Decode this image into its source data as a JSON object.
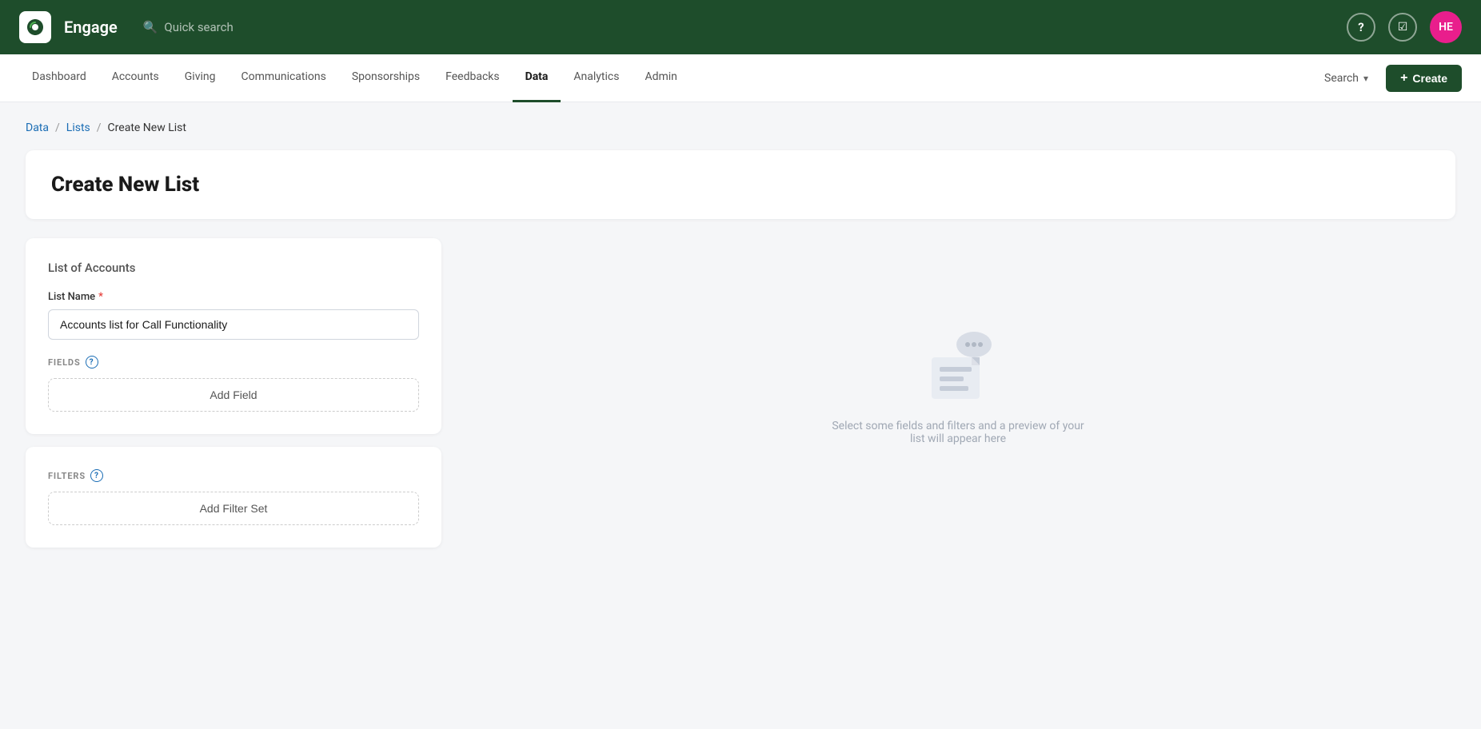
{
  "app": {
    "brand": "Engage",
    "logo_alt": "engage-logo"
  },
  "topbar": {
    "quick_search_placeholder": "Quick search",
    "avatar_initials": "HE",
    "avatar_color": "#e91e8c",
    "help_icon": "?",
    "checklist_icon": "✓"
  },
  "mainnav": {
    "items": [
      {
        "label": "Dashboard",
        "active": false
      },
      {
        "label": "Accounts",
        "active": false
      },
      {
        "label": "Giving",
        "active": false
      },
      {
        "label": "Communications",
        "active": false
      },
      {
        "label": "Sponsorships",
        "active": false
      },
      {
        "label": "Feedbacks",
        "active": false
      },
      {
        "label": "Data",
        "active": true
      },
      {
        "label": "Analytics",
        "active": false
      },
      {
        "label": "Admin",
        "active": false
      }
    ],
    "search_label": "Search",
    "create_label": "Create"
  },
  "breadcrumb": {
    "items": [
      {
        "label": "Data",
        "link": true
      },
      {
        "label": "Lists",
        "link": true
      },
      {
        "label": "Create New List",
        "link": false
      }
    ]
  },
  "page": {
    "title": "Create New List"
  },
  "form": {
    "section_subtitle": "List of Accounts",
    "list_name_label": "List Name",
    "list_name_required": true,
    "list_name_value": "Accounts list for Call Functionality",
    "fields_label": "FIELDS",
    "add_field_label": "Add Field",
    "filters_label": "FILTERS",
    "add_filter_set_label": "Add Filter Set"
  },
  "preview": {
    "text": "Select some fields and filters and a preview of your list will appear here"
  },
  "icons": {
    "search": "🔍",
    "plus": "+",
    "chevron_down": "▾",
    "help": "?",
    "question_circle": "?"
  }
}
